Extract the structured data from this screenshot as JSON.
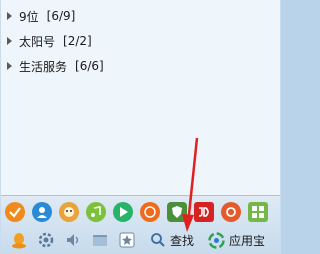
{
  "groups": [
    {
      "name": "9位",
      "count": "[6/9]"
    },
    {
      "name": "太阳号",
      "count": "[2/2]"
    },
    {
      "name": "生活服务",
      "count": "[6/6]"
    }
  ],
  "toolbar": {
    "find_label": "查找",
    "appstore_label": "应用宝"
  },
  "apps": [
    {
      "icon": "qq-mail-icon",
      "color": "#f08a1c"
    },
    {
      "icon": "qq-friend-icon",
      "color": "#2a8ad6"
    },
    {
      "icon": "qq-pet-icon",
      "color": "#e8a33a"
    },
    {
      "icon": "qq-music-icon",
      "color": "#7cc13a"
    },
    {
      "icon": "video-play-icon",
      "color": "#27b36a"
    },
    {
      "icon": "coin-icon",
      "color": "#f06a1c"
    },
    {
      "icon": "shield-icon",
      "color": "#4a8f3a"
    },
    {
      "icon": "jd-icon",
      "color": "#d32323"
    },
    {
      "icon": "qq-browser-icon",
      "color": "#e55a2b"
    },
    {
      "icon": "apps-grid-icon",
      "color": "#74b84a"
    }
  ],
  "colors": {
    "accent": "#e02020",
    "panel_bg": "#eef5fb"
  }
}
